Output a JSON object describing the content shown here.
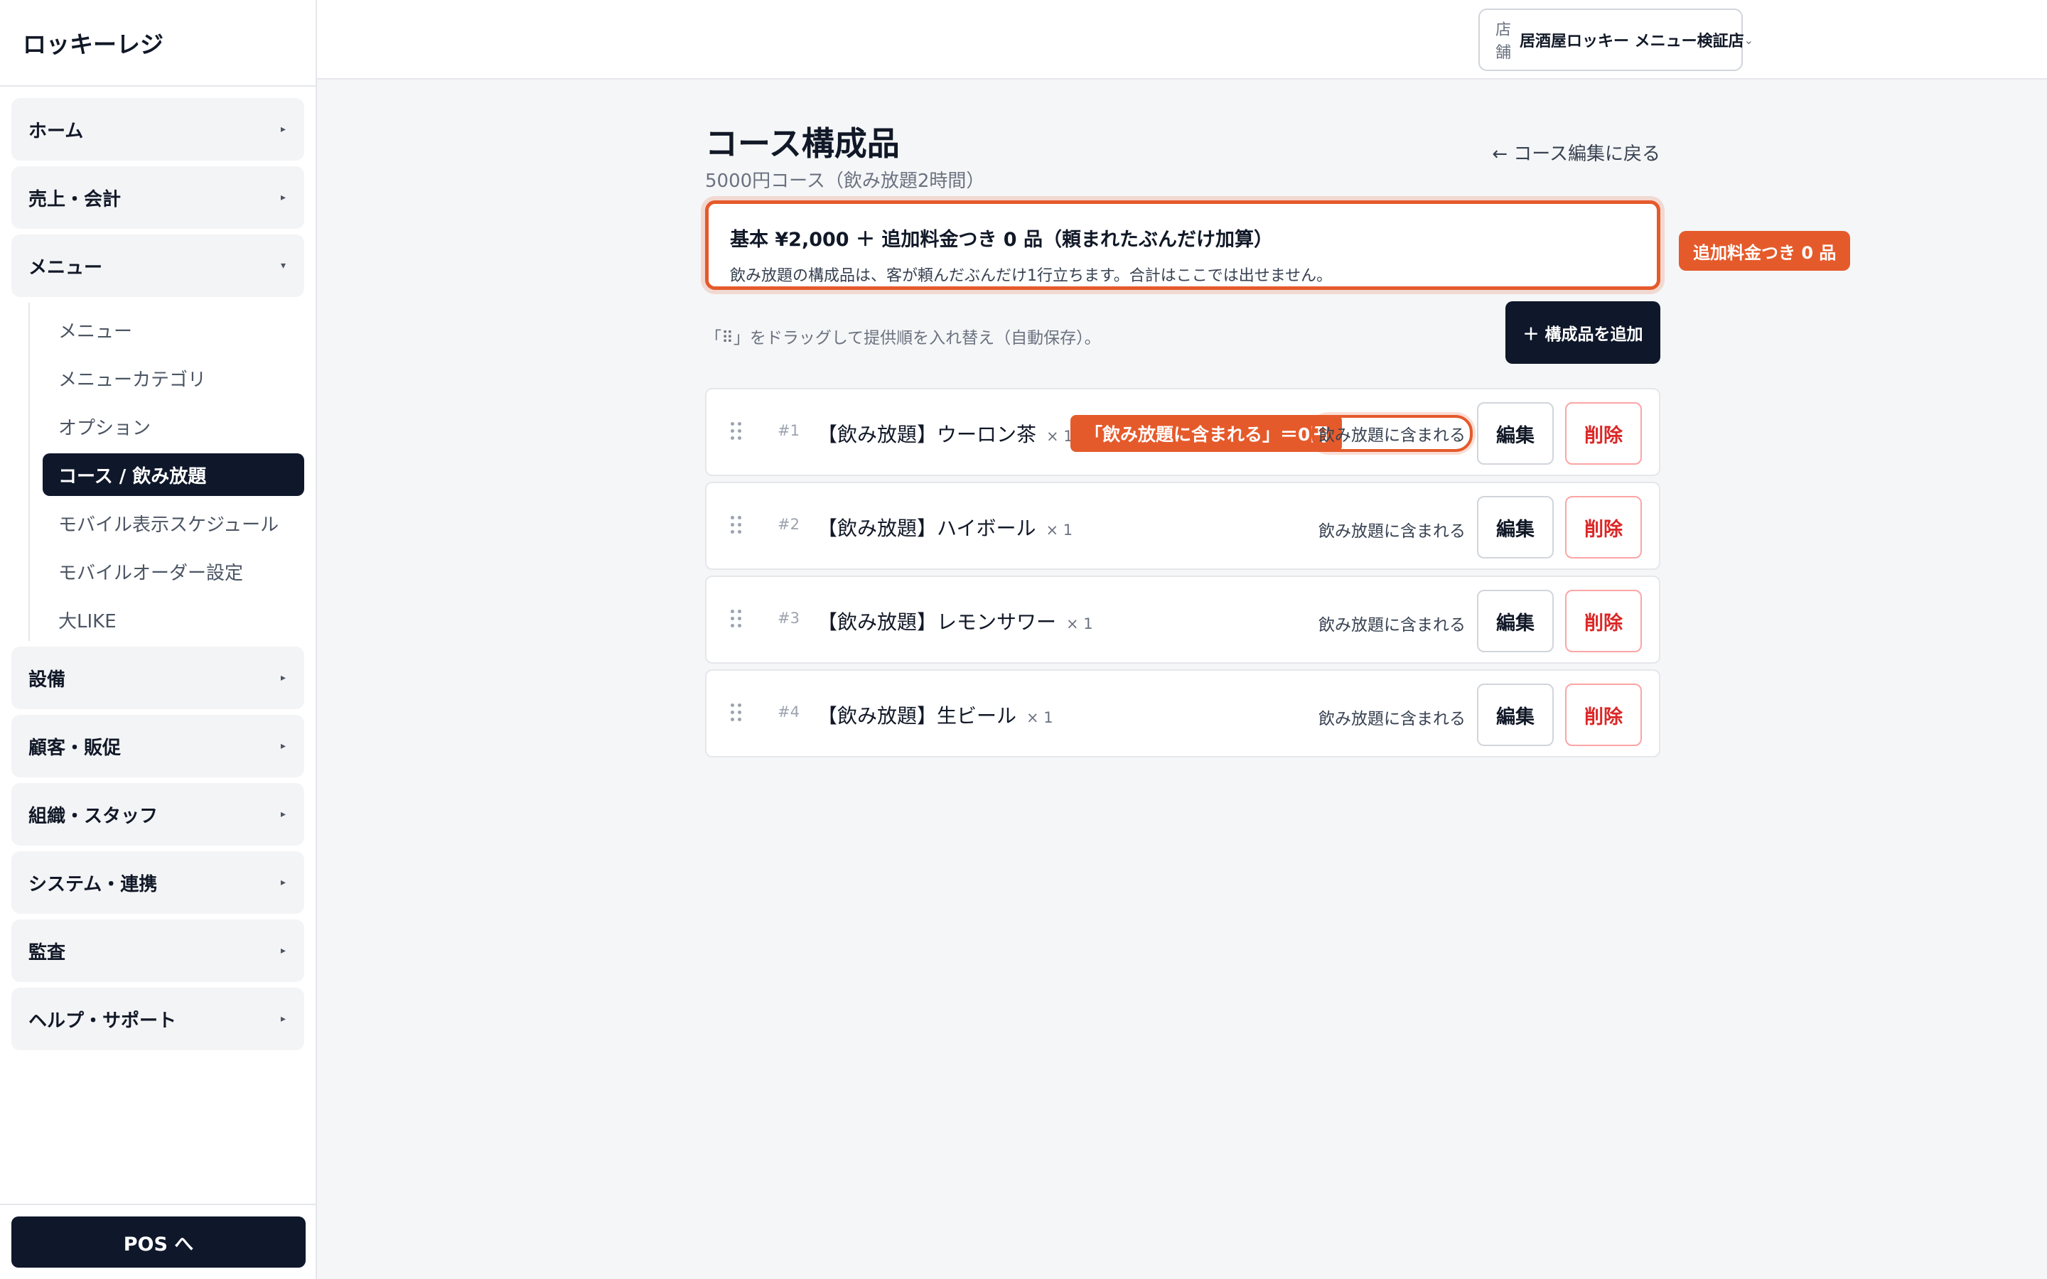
{
  "app": {
    "brand": "ロッキーレジ"
  },
  "sidebar": {
    "groups_top": [
      {
        "label": "ホーム",
        "icon": "caret-right-icon"
      },
      {
        "label": "売上・会計",
        "icon": "caret-right-icon"
      }
    ],
    "menu_group": {
      "label": "メニュー",
      "icon": "caret-down-icon",
      "items": [
        {
          "label": "メニュー"
        },
        {
          "label": "メニューカテゴリ"
        },
        {
          "label": "オプション"
        },
        {
          "label": "コース / 飲み放題"
        },
        {
          "label": "モバイル表示スケジュール"
        },
        {
          "label": "モバイルオーダー設定"
        },
        {
          "label": "大LIKE"
        }
      ],
      "active_index": 3
    },
    "groups_bottom": [
      {
        "label": "設備",
        "icon": "caret-right-icon"
      },
      {
        "label": "顧客・販促",
        "icon": "caret-right-icon"
      },
      {
        "label": "組織・スタッフ",
        "icon": "caret-right-icon"
      },
      {
        "label": "システム・連携",
        "icon": "caret-right-icon"
      },
      {
        "label": "監査",
        "icon": "caret-right-icon"
      },
      {
        "label": "ヘルプ・サポート",
        "icon": "caret-right-icon"
      }
    ],
    "pos_button": "POS へ"
  },
  "topbar": {
    "store_label": "店舗",
    "store_name": "居酒屋ロッキー メニュー検証店"
  },
  "page": {
    "title": "コース構成品",
    "subtitle": "5000円コース（飲み放題2時間）",
    "back_link": "← コース編集に戻る",
    "summary": {
      "main": "基本 ¥2,000 ＋ 追加料金つき 0 品（頼まれたぶんだけ加算）",
      "note": "飲み放題の構成品は、客が頼んだぶんだけ1行立ちます。合計はここでは出せません。",
      "tag": "追加料金つき 0 品"
    },
    "drag_hint": "「⠿」をドラッグして提供順を入れ替え（自動保存）。",
    "add_button": "＋ 構成品を追加",
    "edit_label": "編集",
    "delete_label": "削除",
    "items": [
      {
        "no": "#1",
        "name": "【飲み放題】ウーロン茶",
        "qty": "× 1",
        "tag": "「飲み放題に含まれる」＝0円",
        "status": "飲み放題に含まれる"
      },
      {
        "no": "#2",
        "name": "【飲み放題】ハイボール",
        "qty": "× 1",
        "status": "飲み放題に含まれる"
      },
      {
        "no": "#3",
        "name": "【飲み放題】レモンサワー",
        "qty": "× 1",
        "status": "飲み放題に含まれる"
      },
      {
        "no": "#4",
        "name": "【飲み放題】生ビール",
        "qty": "× 1",
        "status": "飲み放題に含まれる"
      }
    ]
  },
  "colors": {
    "accent_orange": "#e55a2b",
    "dark_navy": "#0f172a",
    "danger_red": "#dc2626"
  }
}
